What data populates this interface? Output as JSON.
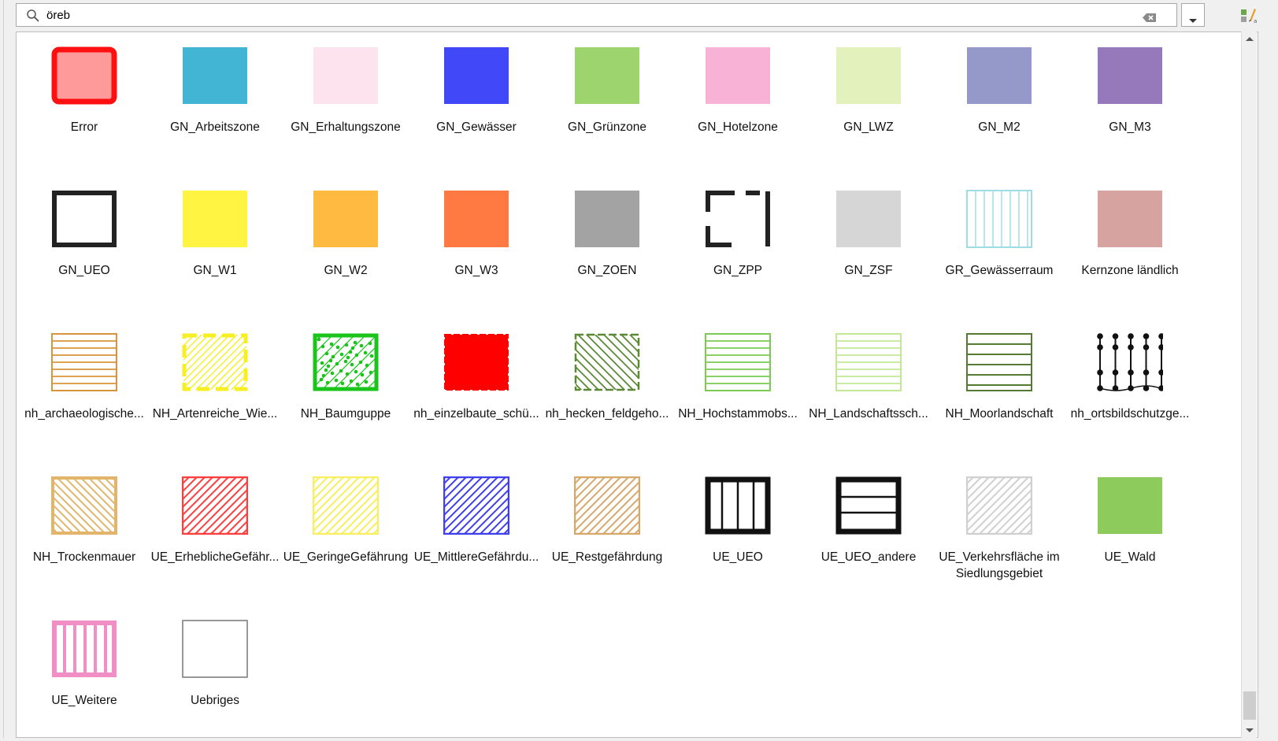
{
  "search": {
    "value": "öreb"
  },
  "symbols": [
    {
      "label": "Error",
      "pattern": "error",
      "colors": {
        "fill": "#ff9a9a",
        "stroke": "#ff1010"
      }
    },
    {
      "label": "GN_Arbeitszone",
      "pattern": "solid",
      "colors": {
        "fill": "#42b4d4"
      }
    },
    {
      "label": "GN_Erhaltungszone",
      "pattern": "solid",
      "colors": {
        "fill": "#fde3ee"
      }
    },
    {
      "label": "GN_Gewässer",
      "pattern": "solid",
      "colors": {
        "fill": "#4148f8"
      }
    },
    {
      "label": "GN_Grünzone",
      "pattern": "solid",
      "colors": {
        "fill": "#9dd46e"
      }
    },
    {
      "label": "GN_Hotelzone",
      "pattern": "solid",
      "colors": {
        "fill": "#f8b2d6"
      }
    },
    {
      "label": "GN_LWZ",
      "pattern": "solid",
      "colors": {
        "fill": "#e3f2bc"
      }
    },
    {
      "label": "GN_M2",
      "pattern": "solid",
      "colors": {
        "fill": "#9499c9"
      }
    },
    {
      "label": "GN_M3",
      "pattern": "solid",
      "colors": {
        "fill": "#9679ba"
      }
    },
    {
      "label": "GN_UEO",
      "pattern": "outline",
      "colors": {
        "stroke": "#222222"
      }
    },
    {
      "label": "GN_W1",
      "pattern": "solid",
      "colors": {
        "fill": "#fff442"
      }
    },
    {
      "label": "GN_W2",
      "pattern": "solid",
      "colors": {
        "fill": "#ffba42"
      }
    },
    {
      "label": "GN_W3",
      "pattern": "solid",
      "colors": {
        "fill": "#ff7a42"
      }
    },
    {
      "label": "GN_ZOEN",
      "pattern": "solid",
      "colors": {
        "fill": "#a3a3a3"
      }
    },
    {
      "label": "GN_ZPP",
      "pattern": "bracket",
      "colors": {
        "stroke": "#222222"
      }
    },
    {
      "label": "GN_ZSF",
      "pattern": "solid",
      "colors": {
        "fill": "#d6d6d6"
      }
    },
    {
      "label": "GR_Gewässerraum",
      "pattern": "vlines",
      "colors": {
        "stroke": "#9fdde6"
      }
    },
    {
      "label": "Kernzone ländlich",
      "pattern": "solid",
      "colors": {
        "fill": "#d6a3a0"
      }
    },
    {
      "label": "nh_archaeologische...",
      "pattern": "hlines",
      "colors": {
        "stroke": "#d8943a"
      }
    },
    {
      "label": "NH_Artenreiche_Wie...",
      "pattern": "dashed-diag",
      "colors": {
        "stroke": "#f5ef24"
      }
    },
    {
      "label": "NH_Baumguppe",
      "pattern": "dots-diag",
      "colors": {
        "stroke": "#1ac41a"
      }
    },
    {
      "label": "nh_einzelbaute_schü...",
      "pattern": "solid-dashed",
      "colors": {
        "fill": "#ff0000"
      }
    },
    {
      "label": "nh_hecken_feldgeho...",
      "pattern": "dashed-diag-rev",
      "colors": {
        "stroke": "#5b8a35"
      }
    },
    {
      "label": "NH_Hochstammobs...",
      "pattern": "hlines",
      "colors": {
        "stroke": "#79cc52"
      }
    },
    {
      "label": "NH_Landschaftssch...",
      "pattern": "hlines",
      "colors": {
        "stroke": "#c2e895"
      }
    },
    {
      "label": "NH_Moorlandschaft",
      "pattern": "hlines-wide",
      "colors": {
        "stroke": "#557a33"
      }
    },
    {
      "label": "nh_ortsbildschutzge...",
      "pattern": "dotted-lines",
      "colors": {
        "stroke": "#111111"
      }
    },
    {
      "label": "NH_Trockenmauer",
      "pattern": "diag-rev-thick",
      "colors": {
        "stroke": "#e3b56a"
      }
    },
    {
      "label": "UE_ErheblicheGefähr...",
      "pattern": "diag",
      "colors": {
        "stroke": "#ff3d3d"
      }
    },
    {
      "label": "UE_GeringeGefährung",
      "pattern": "diag",
      "colors": {
        "stroke": "#f7ef5e"
      }
    },
    {
      "label": "UE_MittlereGefährdu...",
      "pattern": "diag",
      "colors": {
        "stroke": "#3f3ff0"
      }
    },
    {
      "label": "UE_Restgefährdung",
      "pattern": "diag",
      "colors": {
        "stroke": "#d8a86a"
      }
    },
    {
      "label": "UE_UEO",
      "pattern": "thick-vlines",
      "colors": {
        "stroke": "#111111"
      }
    },
    {
      "label": "UE_UEO_andere",
      "pattern": "thick-hlines",
      "colors": {
        "stroke": "#111111"
      }
    },
    {
      "label": "UE_Verkehrsfläche im Siedlungsgebiet",
      "pattern": "diag",
      "colors": {
        "stroke": "#d0d0d0"
      }
    },
    {
      "label": "UE_Wald",
      "pattern": "solid",
      "colors": {
        "fill": "#8ccb5c"
      }
    },
    {
      "label": "UE_Weitere",
      "pattern": "pink-vlines",
      "colors": {
        "stroke": "#f08ec5"
      }
    },
    {
      "label": "Uebriges",
      "pattern": "outline-thin",
      "colors": {
        "stroke": "#777777"
      }
    }
  ]
}
